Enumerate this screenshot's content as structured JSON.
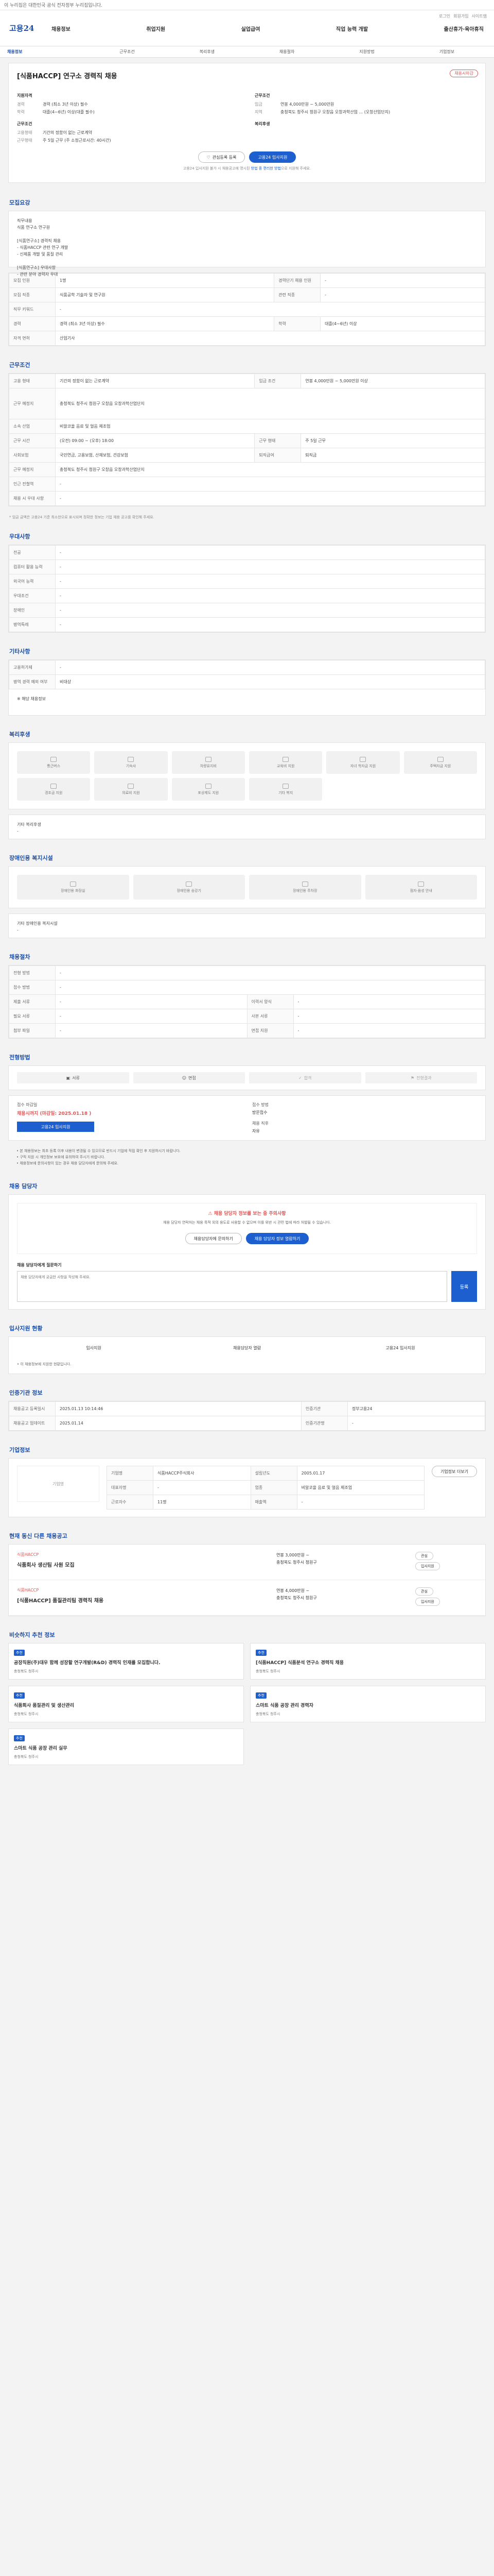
{
  "topbar": "이 누리집은 대한민국 공식 전자정부 누리집입니다.",
  "util": [
    "로그인",
    "회원가입",
    "사이트맵"
  ],
  "logo": "고용24",
  "gnb": [
    "채용정보",
    "취업지원",
    "실업급여",
    "직업 능력 개발",
    "출산휴가·육아휴직"
  ],
  "tabs": [
    "채용정보",
    "근무조건",
    "복리후생",
    "채용절차",
    "지원방법",
    "기업정보"
  ],
  "job": {
    "title": "[식품HACCP] 연구소 경력직 채용",
    "badge": "채용시마감",
    "left": [
      {
        "k": "경력",
        "v": "경력 (최소 3년 이상) 필수"
      },
      {
        "k": "학력",
        "v": "대졸(4~6년) 이상(대졸 필수)"
      }
    ],
    "right": [
      {
        "k": "임금",
        "v": "연봉 4,000만원 ~ 5,000만원"
      },
      {
        "k": "지역",
        "v": "충청북도 청주시 청원구 오창읍 오창과학산업 ... (오창산업단지)"
      }
    ],
    "cond_h": "근무조건",
    "cond": [
      {
        "k": "고용형태",
        "v": "기간의 정함이 없는 근로계약"
      },
      {
        "k": "근무형태",
        "v": "주 5일 근무 (주 소정근로시간: 40시간)"
      }
    ],
    "cond_r": "복리후생",
    "btn_save": "관심등록 등록",
    "btn_apply": "고용24 입사지원",
    "hint1": "고용24 입사지원 불가 시 채용공고에 명시된 ",
    "hint2": "방법 중 편리한 방법",
    "hint3": "으로 지원해 주세요."
  },
  "desc": {
    "title": "모집요강",
    "text": "직무내용\n식품 연구소 연구원\n\n[식품연구소] 경력직 채용\n- 식품HACCP 관련 연구 개발\n- 신제품 개발 및 품질 관리\n\n[식품연구소] 우대사항\n- 관련 분야 경력자 우대"
  },
  "recruit": {
    "rows": [
      [
        "모집 인원",
        "1명",
        "경력단기 채용 인원",
        "-"
      ],
      [
        "모집 직종",
        "식품공학 기술자 및 연구원",
        "관련 직종",
        "-"
      ],
      [
        "직무 키워드",
        "-",
        "",
        ""
      ],
      [
        "경력",
        "경력 (최소 3년 이상) 필수",
        "학력",
        "대졸(4~6년) 이상"
      ],
      [
        "자격 면허",
        "산업기사",
        "",
        ""
      ]
    ]
  },
  "work": {
    "title": "근무조건",
    "rows": [
      [
        "고용 형태",
        "기간의 정함이 없는 근로계약",
        "임금 조건",
        "연봉 4,000만원 ~ 5,000만원 이상"
      ],
      [
        "근무 예정지",
        "충청북도 청주시 청원구 오창읍 오창과학산업단지",
        "",
        ""
      ],
      [
        "소속 산업",
        "비알코올 음료 및 얼음 제조업",
        "",
        ""
      ],
      [
        "근무 시간",
        "(오전) 09:00 ~ (오후) 18:00",
        "근무 형태",
        "주 5일 근무"
      ],
      [
        "사회보험",
        "국민연금, 고용보험, 산재보험, 건강보험",
        "퇴직급여",
        "퇴직금"
      ],
      [
        "근무 예정지",
        "충청북도 청주시 청원구 오창읍 오창과학산업단지",
        "",
        ""
      ],
      [
        "인근 전철역",
        "-",
        "",
        ""
      ],
      [
        "채용 시 우대 사항",
        "-",
        "",
        ""
      ]
    ],
    "notice": "* 임금 금액은 고용24 기준 최소한으로 표시되며 정확한 정보는 기업 채용 공고를 확인해 주세요."
  },
  "pref": {
    "title": "우대사항",
    "rows": [
      [
        "전공",
        "-"
      ],
      [
        "컴퓨터 활용 능력",
        "-"
      ],
      [
        "외국어 능력",
        "-"
      ],
      [
        "우대조건",
        "-"
      ],
      [
        "장애인",
        "-"
      ],
      [
        "병역특례",
        "-"
      ]
    ]
  },
  "etc": {
    "title": "기타사항",
    "rows": [
      [
        "고용허가제",
        "-"
      ],
      [
        "병역 경력 예외 여부",
        "비대상"
      ]
    ],
    "note": "※ 해당 채용정보"
  },
  "welfare": {
    "title": "복리후생",
    "items": [
      "통근버스",
      "기숙사",
      "차량유지비",
      "교육비 지원",
      "자녀 학자금 지원",
      "주택자금 지원",
      "경조금 지원",
      "의료비 지원",
      "포상제도 지원",
      "기타 복지"
    ],
    "etc_k": "기타 복리후생",
    "etc_v": "-"
  },
  "disabled": {
    "title": "장애인용 복지시설",
    "items": [
      "장애인용 화장실",
      "장애인용 승강기",
      "장애인용 주차장",
      "점자·음성 안내"
    ],
    "etc_k": "기타 장애인용 복지시설",
    "etc_v": "-"
  },
  "proc": {
    "title": "채용절차",
    "rows": [
      [
        "전형 방법",
        "-",
        "",
        ""
      ],
      [
        "접수 방법",
        "-",
        "",
        ""
      ],
      [
        "제출 서류",
        "-",
        "이력서 양식",
        "-"
      ],
      [
        "필요 서류",
        "-",
        "사본 서류",
        "-"
      ],
      [
        "첨부 파일",
        "-",
        "면접 지원",
        "-"
      ]
    ]
  },
  "apply": {
    "title": "전형방법",
    "steps": [
      "서류",
      "면접",
      "합격",
      "전형결과"
    ],
    "dl_k": "접수 마감일",
    "dl_v": "채용시까지 (마감일: 2025.01.18 )",
    "dl2_k": "접수 방법",
    "dl2_v": "방문접수",
    "r_k": "채용 직후",
    "r_v": "자유",
    "btn": "고용24 입사지원",
    "notes": [
      "• 본 채용정보는 최초 등록 이후 내용이 변경될 수 있으므로 반드시 기업에 직접 확인 후 지원하시기 바랍니다.",
      "• 구직 지원 시 개인정보 보호에 유의하여 주시기 바랍니다.",
      "• 채용정보에 문의사항이 있는 경우 채용 담당자에게 문의해 주세요."
    ]
  },
  "contact": {
    "title": "채용 담당자",
    "warn": "채용 담당자 정보를 보는 중 주의사항",
    "warn_d": "채용 담당자 연락처는 채용 목적 외의 용도로 사용할 수 없으며 이를 위반 시 관련 법에 따라 처벌될 수 있습니다.",
    "btn1": "채용담당자에 문의하기",
    "btn2": "채용 담당자 정보 열람하기",
    "inq_t": "채용 담당자에게 질문하기",
    "inq_p": "채용 담당자에게 궁금한 사항을 작성해 주세요.",
    "send": "등록"
  },
  "status": {
    "title": "입사지원 현황",
    "a": "입사지원",
    "b": "채용담당자 열람",
    "c": "고용24 입사지원",
    "note": "• 이 채용정보에 지원한 현황입니다."
  },
  "info": {
    "title": "인증기관 정보",
    "rows": [
      [
        "채용공고 등록일시",
        "2025.01.13 10:14:46",
        "인증기관",
        "정부고용24"
      ],
      [
        "채용공고 업데이트",
        "2025.01.14",
        "인증기관명",
        "-"
      ]
    ]
  },
  "company": {
    "title": "기업정보",
    "name": "기업명",
    "rows": [
      [
        "기업명",
        "식품HACCP주식회사",
        "설립년도",
        "2005.01.17"
      ],
      [
        "대표자명",
        "-",
        "업종",
        "비알코올 음료 및 얼음 제조업"
      ],
      [
        "근로자수",
        "11명",
        "매출액",
        "-"
      ]
    ],
    "btn": "기업정보 더보기"
  },
  "similar": {
    "title": "현재 동신 다른 채용공고",
    "more": "채용공고 더보기",
    "items": [
      {
        "co": "식품HACCP",
        "title": "식품회사 생산팀 사원 모집",
        "pay": "연봉 3,000만원 ~",
        "loc": "충청북도 청주시 청원구"
      },
      {
        "co": "식품HACCP",
        "title": "[식품HACCP] 품질관리팀 경력직 채용",
        "pay": "연봉 4,000만원 ~",
        "loc": "충청북도 청주시 청원구"
      }
    ]
  },
  "rec": {
    "title": "비슷하지 추천 정보",
    "items": [
      {
        "t": "공장직원(주)대우 함께 성장할 연구개발(R&D) 경력직 인재를 모집합니다.",
        "loc": "충청북도 청주시"
      },
      {
        "t": "[식품HACCP] 식품분석 연구소 경력직 채용",
        "loc": "충청북도 청주시"
      },
      {
        "t": "식품회사 품질관리 및 생산관리",
        "loc": "충청북도 청주시"
      },
      {
        "t": "스마트 식품 공장 관리 경력자",
        "loc": "충청북도 청주시"
      },
      {
        "t": "스마트 식품 공장 관리 실무",
        "loc": "충청북도 청주시"
      }
    ]
  }
}
